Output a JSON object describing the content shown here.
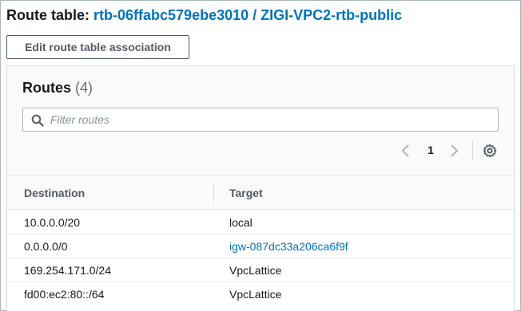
{
  "header": {
    "prefix": "Route table: ",
    "route_table": "rtb-06ffabc579ebe3010 / ZIGI-VPC2-rtb-public"
  },
  "edit_button": {
    "label": "Edit route table association"
  },
  "routes": {
    "title": "Routes",
    "count": "(4)",
    "search_placeholder": "Filter routes",
    "page": "1",
    "columns": {
      "destination": "Destination",
      "target": "Target"
    },
    "rows": [
      {
        "destination": "10.0.0.0/20",
        "target": "local",
        "target_is_link": false
      },
      {
        "destination": "0.0.0.0/0",
        "target": "igw-087dc33a206ca6f9f",
        "target_is_link": true
      },
      {
        "destination": "169.254.171.0/24",
        "target": "VpcLattice",
        "target_is_link": false
      },
      {
        "destination": "fd00:ec2:80::/64",
        "target": "VpcLattice",
        "target_is_link": false
      }
    ]
  },
  "colors": {
    "link": "#0073bb",
    "text": "#16191f",
    "muted": "#687078"
  },
  "icons": {
    "search": "search-icon",
    "prev": "chevron-left-icon",
    "next": "chevron-right-icon",
    "settings": "gear-icon"
  }
}
